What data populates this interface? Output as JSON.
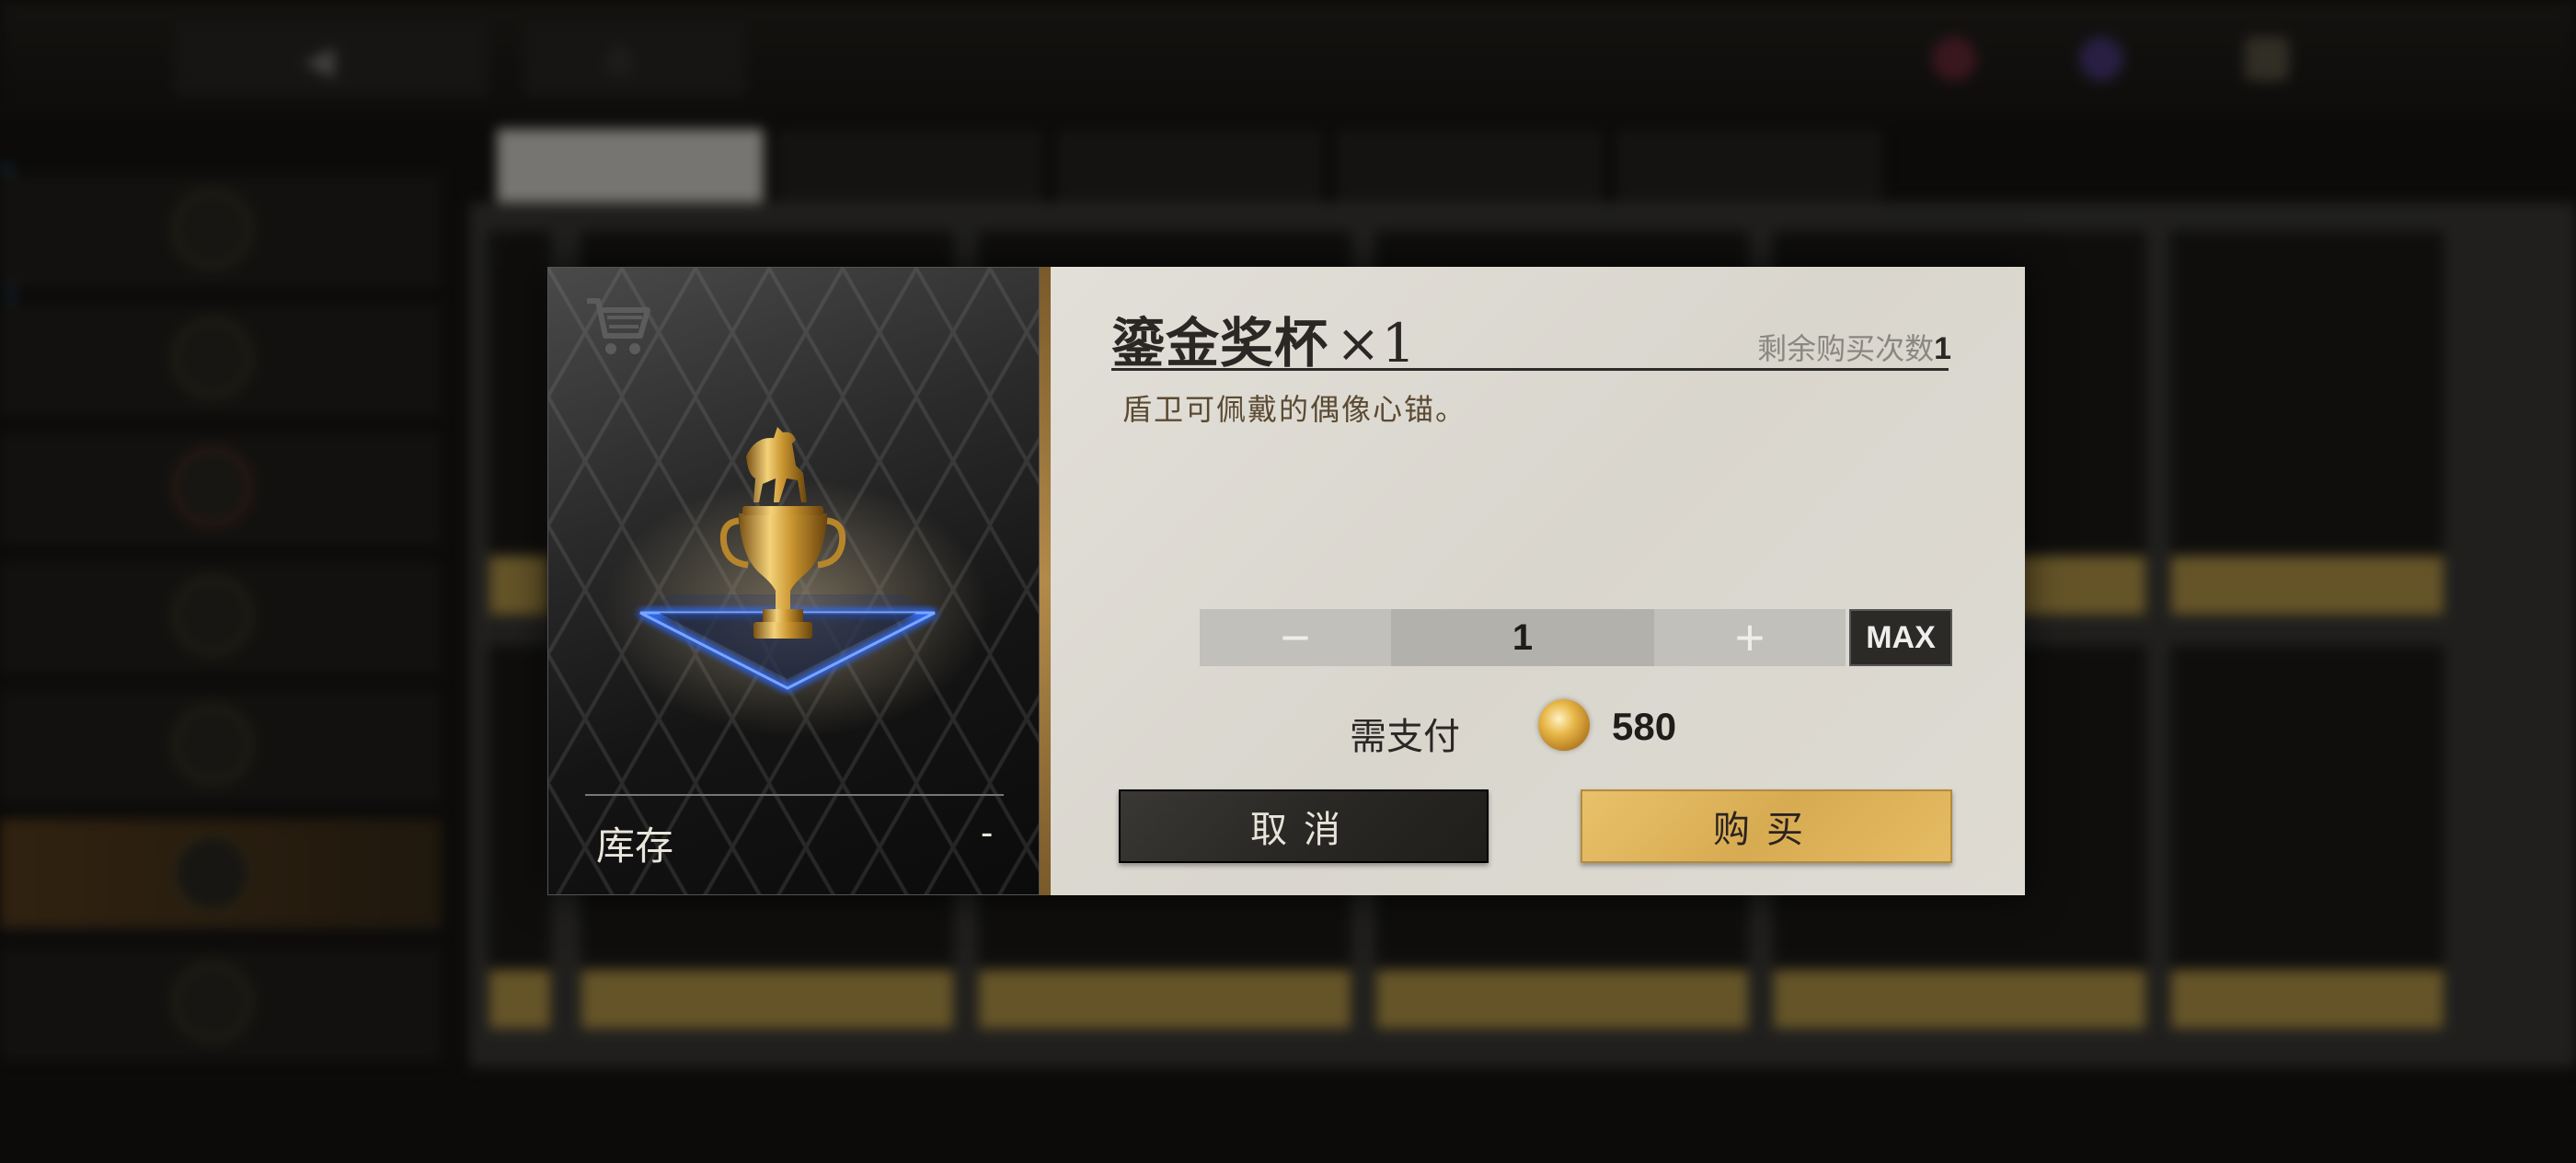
{
  "background": {
    "currencies": [
      {
        "icon": "red-gem-icon",
        "value": "",
        "color": "#7a2a3a"
      },
      {
        "icon": "purple-gem-icon",
        "value": "",
        "color": "#4a3a7a"
      },
      {
        "icon": "ticket-icon",
        "value": "",
        "color": "#5a5444"
      }
    ],
    "tabs": [
      {
        "label": ""
      },
      {
        "label": ""
      },
      {
        "label": ""
      },
      {
        "label": ""
      },
      {
        "label": ""
      }
    ],
    "nav": [
      {
        "label": "",
        "color": "#5a5028"
      },
      {
        "label": "",
        "color": "#5a5028"
      },
      {
        "label": "",
        "color": "#7a3a22"
      },
      {
        "label": "",
        "color": "#5a5028"
      },
      {
        "label": "",
        "color": "#5a5028"
      },
      {
        "label": "",
        "color": "#5a5028"
      },
      {
        "label": "",
        "color": "#5a5028"
      }
    ]
  },
  "modal": {
    "item_title": "鎏金奖杯",
    "quantity_badge": "×1",
    "remaining_label": "剩余购买次数",
    "remaining_count": "1",
    "description": "盾卫可佩戴的偶像心锚。",
    "stock_label": "库存",
    "stock_value": "-",
    "decrement_symbol": "−",
    "quantity": "1",
    "increment_symbol": "+",
    "max_label": "MAX",
    "pay_label": "需支付",
    "pay_amount": "580",
    "cancel_label": "取消",
    "buy_label": "购买",
    "accent_gold": "#d7ab52",
    "accent_dark": "#2a2825"
  }
}
